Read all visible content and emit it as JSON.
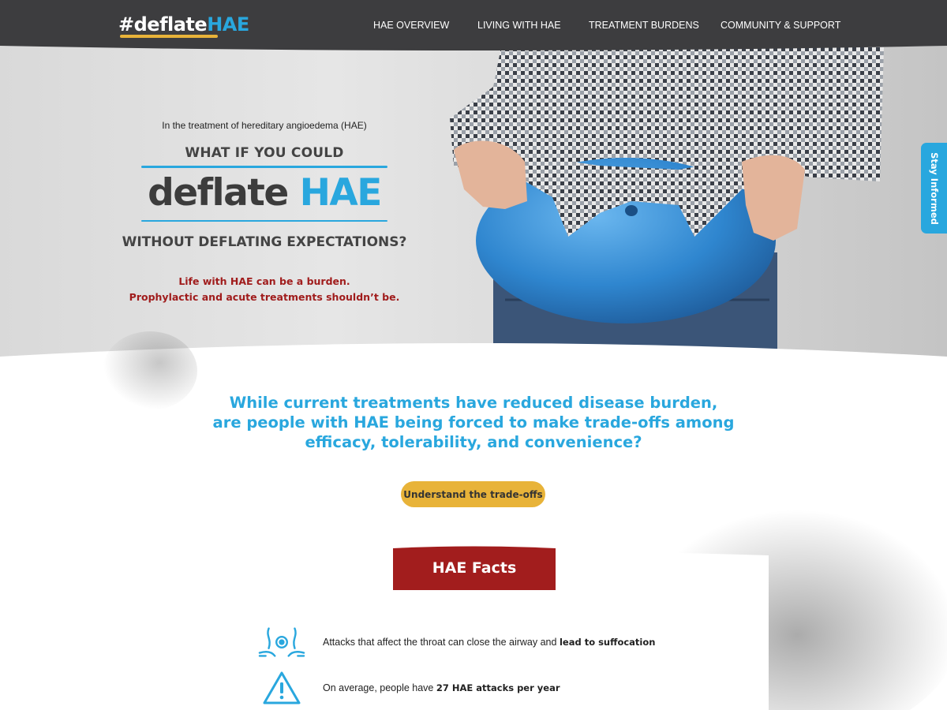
{
  "header": {
    "logo_hash": "#deflate",
    "logo_hae": "HAE",
    "nav": [
      "HAE OVERVIEW",
      "LIVING WITH HAE",
      "TREATMENT BURDENS",
      "COMMUNITY & SUPPORT"
    ]
  },
  "hero": {
    "eyebrow": "In the treatment of hereditary angioedema (HAE)",
    "line1": "WHAT IF YOU COULD",
    "big_word": "deflate",
    "big_hae": "HAE",
    "line2": "WITHOUT DEFLATING EXPECTATIONS?",
    "sub1": "Life with HAE can be a burden.",
    "sub2": "Prophylactic and acute treatments shouldn’t be."
  },
  "stay_tab": "Stay Informed",
  "main": {
    "headline": [
      "While current treatments have reduced disease burden,",
      "are people with HAE being forced to make trade-offs among",
      "efficacy, tolerability, and convenience?"
    ],
    "cta": "Understand the trade-offs"
  },
  "facts": {
    "title": "HAE Facts",
    "items": [
      {
        "icon": "throat-swelling-icon",
        "text": "Attacks that affect the throat can close the airway and ",
        "bold": "lead to suffocation"
      },
      {
        "icon": "warning-triangle-icon",
        "text": "On average, people have ",
        "bold": "27 HAE attacks per year"
      }
    ]
  },
  "colors": {
    "header_bg": "#3d3d3f",
    "accent_blue": "#29a7de",
    "cta_gold": "#e8b339",
    "banner_red": "#a21d1d",
    "burden_red": "#a01c1c"
  }
}
